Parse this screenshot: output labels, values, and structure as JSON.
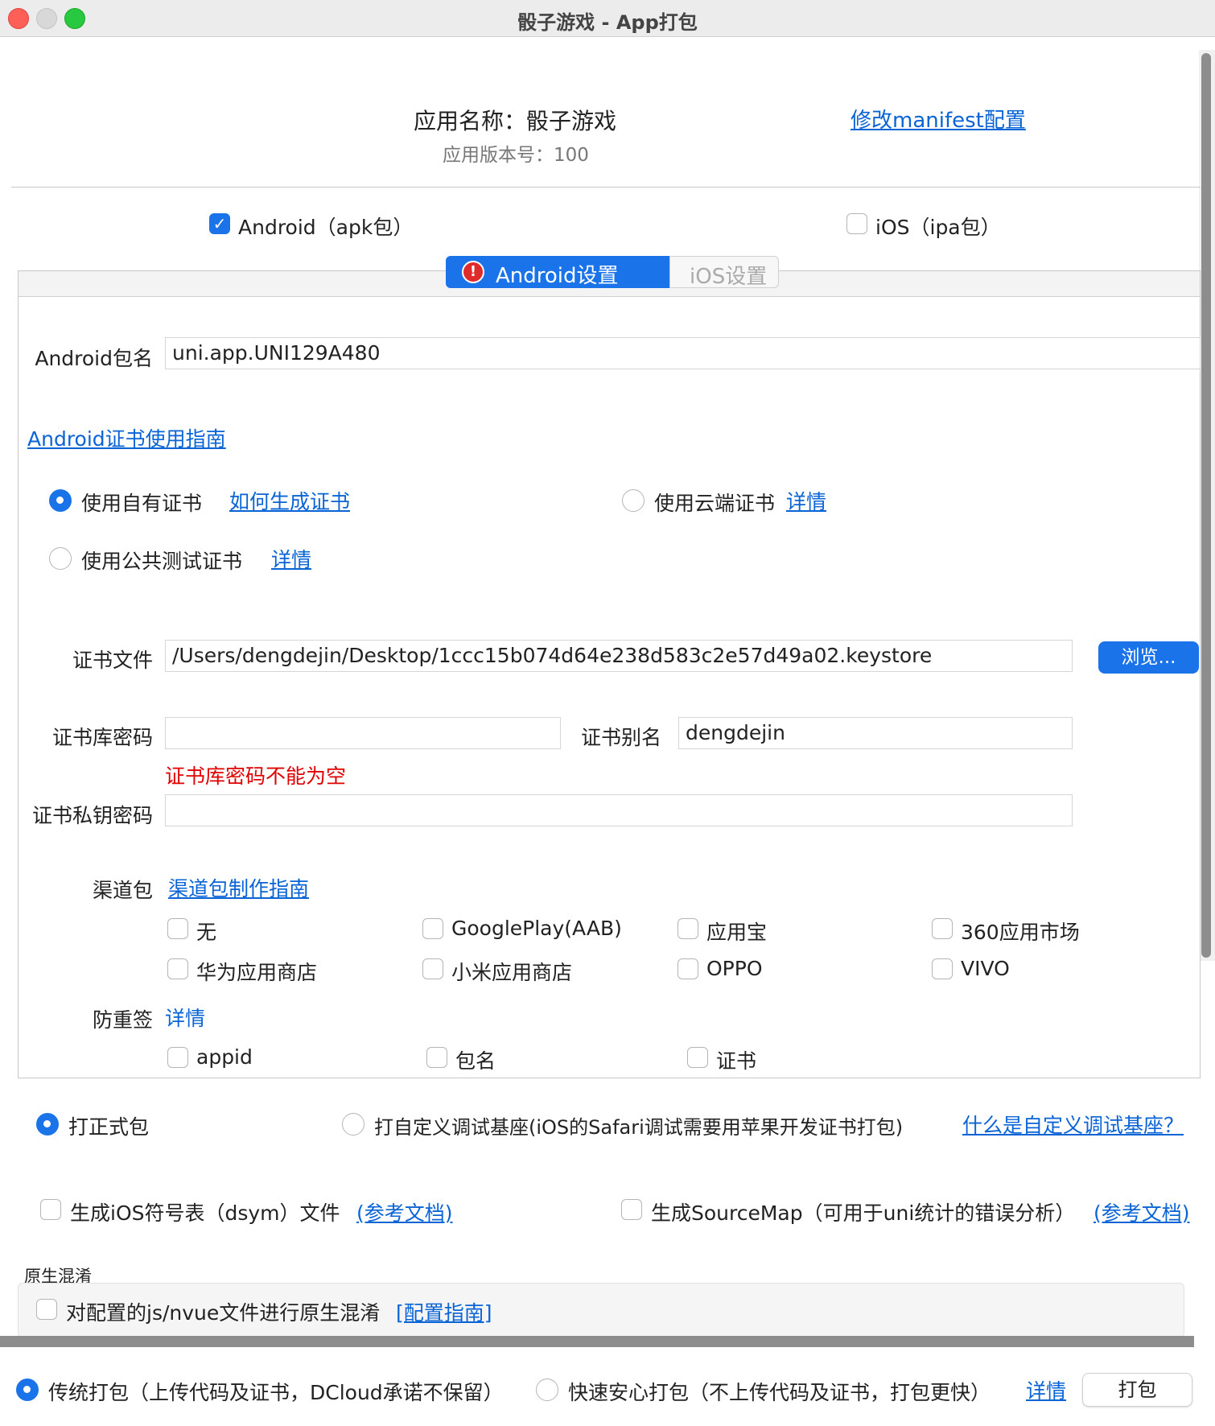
{
  "window": {
    "title": "骰子游戏 - App打包"
  },
  "app": {
    "name_label": "应用名称：骰子游戏",
    "version_label": "应用版本号：100",
    "edit_manifest_link": "修改manifest配置"
  },
  "platforms": {
    "android_label": "Android（apk包）",
    "android_checked": true,
    "ios_label": "iOS（ipa包）",
    "ios_checked": false
  },
  "tabs": {
    "android": "Android设置",
    "ios": "iOS设置",
    "active": "android"
  },
  "android": {
    "package_label": "Android包名",
    "package_value": "uni.app.UNI129A480",
    "cert_guide_link": "Android证书使用指南",
    "cert_options": {
      "own_label": "使用自有证书",
      "own_link": "如何生成证书",
      "cloud_label": "使用云端证书",
      "cloud_link": "详情",
      "public_label": "使用公共测试证书",
      "public_link": "详情",
      "selected": "own"
    },
    "cert_file_label": "证书文件",
    "cert_file_value": "/Users/dengdejin/Desktop/1ccc15b074d64e238d583c2e57d49a02.keystore",
    "browse_button": "浏览...",
    "keystore_pwd_label": "证书库密码",
    "keystore_pwd_value": "",
    "alias_label": "证书别名",
    "alias_value": "dengdejin",
    "error_text": "证书库密码不能为空",
    "private_key_label": "证书私钥密码",
    "private_key_value": "",
    "channel_label": "渠道包",
    "channel_guide_link": "渠道包制作指南",
    "channels": [
      "无",
      "GooglePlay(AAB)",
      "应用宝",
      "360应用市场",
      "华为应用商店",
      "小米应用商店",
      "OPPO",
      "VIVO"
    ],
    "anti_label": "防重签",
    "anti_link": "详情",
    "anti_options": [
      "appid",
      "包名",
      "证书"
    ]
  },
  "build_type": {
    "release_label": "打正式包",
    "custom_base_label": "打自定义调试基座(iOS的Safari调试需要用苹果开发证书打包)",
    "custom_base_link": "什么是自定义调试基座？",
    "selected": "release"
  },
  "extras": {
    "dsym_label": "生成iOS符号表（dsym）文件",
    "dsym_link": "(参考文档)",
    "sourcemap_label": "生成SourceMap（可用于uni统计的错误分析）",
    "sourcemap_link": "(参考文档)"
  },
  "obfuscation": {
    "section_title": "原生混淆",
    "label": "对配置的js/nvue文件进行原生混淆",
    "link": "[配置指南]"
  },
  "footer": {
    "traditional_label": "传统打包（上传代码及证书，DCloud承诺不保留）",
    "fast_label": "快速安心打包（不上传代码及证书，打包更快）",
    "details_link": "详情",
    "pack_button": "打包",
    "selected": "traditional"
  },
  "colors": {
    "accent": "#1a73e8",
    "link": "#0a64d6",
    "error": "#e00000"
  }
}
